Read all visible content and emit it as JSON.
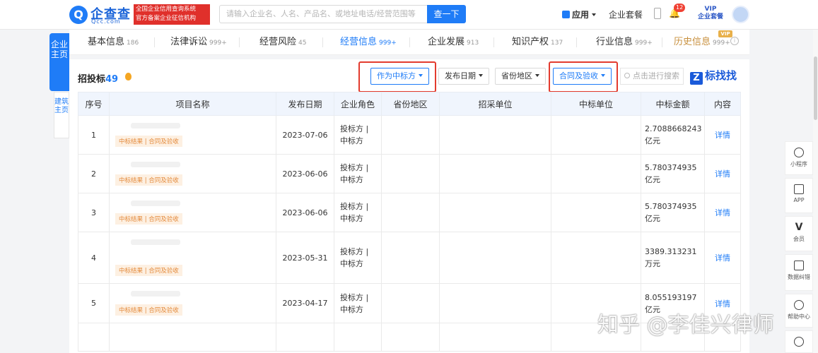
{
  "header": {
    "logo_name": "企查查",
    "logo_domain": "Qcc.com",
    "badge_line1": "全国企业信用查询系统",
    "badge_line2": "官方备案企业征信机构",
    "search_placeholder": "请输入企业名、人名、产品名、或地址电话/经营范围等",
    "search_button": "查一下",
    "apps_label": "应用",
    "package_label": "企业套餐",
    "bell_count": "12",
    "vip_line1": "VIP",
    "vip_line2": "企业套餐"
  },
  "side_tabs": {
    "company_home": "企业主页",
    "building_home": "建筑主页"
  },
  "tabs": [
    {
      "label": "基本信息",
      "count": "186"
    },
    {
      "label": "法律诉讼",
      "count": "999+"
    },
    {
      "label": "经营风险",
      "count": "45"
    },
    {
      "label": "经营信息",
      "count": "999+"
    },
    {
      "label": "企业发展",
      "count": "913"
    },
    {
      "label": "知识产权",
      "count": "137"
    },
    {
      "label": "行业信息",
      "count": "999+"
    },
    {
      "label": "历史信息",
      "count": "999+"
    }
  ],
  "history_vip": "VIP",
  "section": {
    "title": "招投标",
    "count": "49"
  },
  "filters": {
    "role": "作为中标方",
    "date": "发布日期",
    "region": "省份地区",
    "contract": "合同及验收",
    "search_placeholder": "点击进行搜索",
    "brand": "标找找",
    "brand_mark": "Z"
  },
  "table": {
    "headers": [
      "序号",
      "项目名称",
      "发布日期",
      "企业角色",
      "省份地区",
      "招采单位",
      "中标单位",
      "中标金额",
      "内容"
    ],
    "rows": [
      {
        "no": "1",
        "tag": "中标结果 | 合同及验收",
        "date": "2023-07-06",
        "role1": "投标方 |",
        "role2": "中标方",
        "amt1": "2.7088668243",
        "amt2": "亿元",
        "detail": "详情"
      },
      {
        "no": "2",
        "tag": "中标结果 | 合同及验收",
        "date": "2023-06-06",
        "role1": "投标方 |",
        "role2": "中标方",
        "amt1": "5.780374935",
        "amt2": "亿元",
        "detail": "详情"
      },
      {
        "no": "3",
        "tag": "中标结果 | 合同及验收",
        "date": "2023-06-06",
        "role1": "投标方 |",
        "role2": "中标方",
        "amt1": "5.780374935",
        "amt2": "亿元",
        "detail": "详情"
      },
      {
        "no": "4",
        "tag": "中标结果 | 合同及验收",
        "date": "2023-05-31",
        "role1": "投标方 |",
        "role2": "中标方",
        "amt1": "3389.313231",
        "amt2": "万元",
        "detail": "详情"
      },
      {
        "no": "5",
        "tag": "中标结果 | 合同及验收",
        "date": "2023-04-17",
        "role1": "投标方 |",
        "role2": "中标方",
        "amt1": "8.055193197",
        "amt2": "亿元",
        "detail": "详情"
      }
    ]
  },
  "right_toolbar": [
    "小程序",
    "APP",
    "会员",
    "数据纠错",
    "帮助中心"
  ],
  "watermark": "知乎 @李佳兴律师"
}
